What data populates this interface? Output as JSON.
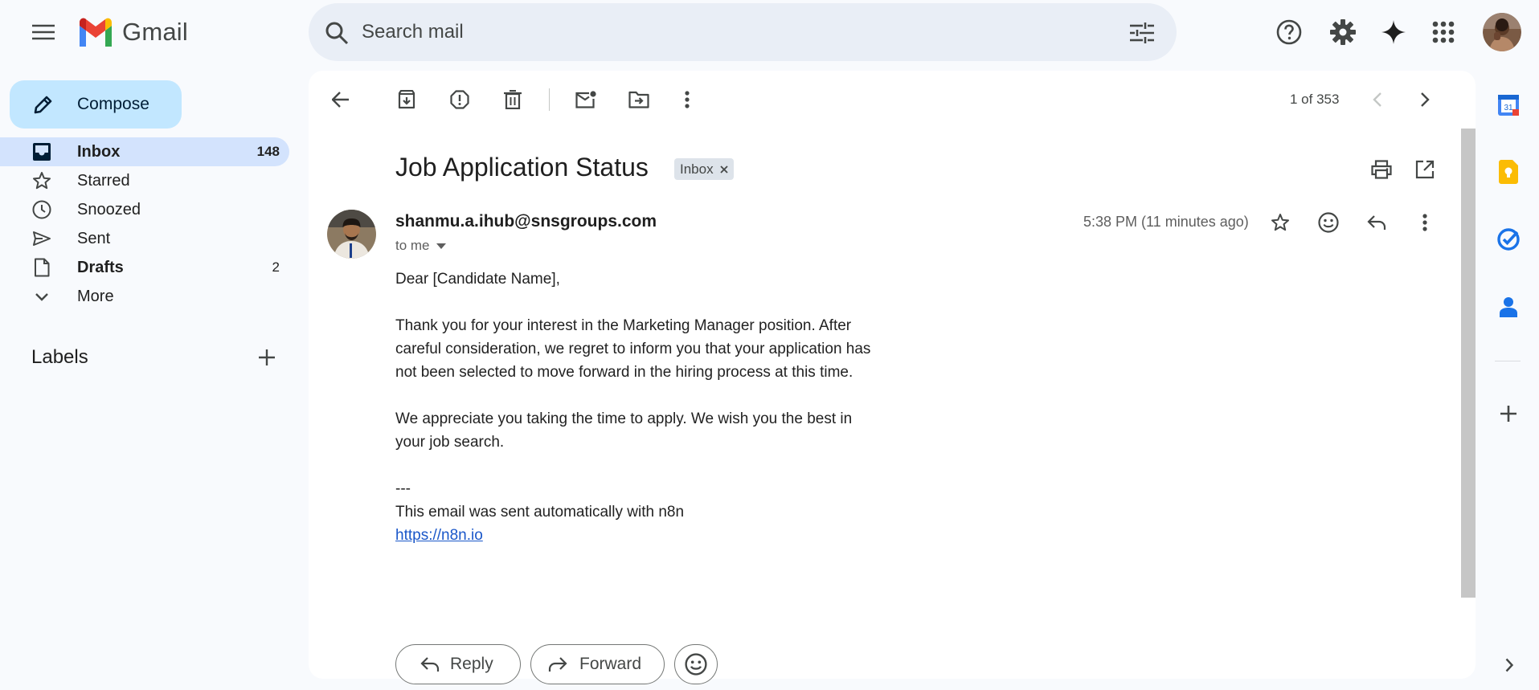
{
  "header": {
    "logo_text": "Gmail",
    "search_placeholder": "Search mail",
    "icons": [
      "menu-icon",
      "search-icon",
      "search-options-icon",
      "help-icon",
      "settings-icon",
      "gemini-icon",
      "apps-icon",
      "account-avatar"
    ]
  },
  "sidebar": {
    "compose_label": "Compose",
    "items": [
      {
        "label": "Inbox",
        "count": "148",
        "icon": "inbox-icon",
        "active": true
      },
      {
        "label": "Starred",
        "count": "",
        "icon": "star-icon"
      },
      {
        "label": "Snoozed",
        "count": "",
        "icon": "clock-icon"
      },
      {
        "label": "Sent",
        "count": "",
        "icon": "send-icon"
      },
      {
        "label": "Drafts",
        "count": "2",
        "icon": "draft-icon"
      },
      {
        "label": "More",
        "count": "",
        "icon": "chevron-down-icon"
      }
    ],
    "labels_title": "Labels"
  },
  "toolbar": {
    "counter": "1 of 353"
  },
  "email": {
    "subject": "Job Application Status",
    "label_chip": "Inbox",
    "sender": "shanmu.a.ihub@snsgroups.com",
    "to": "to me",
    "time": "5:38 PM (11 minutes ago)",
    "body": "Dear [Candidate Name],\n\nThank you for your interest in the Marketing Manager position. After careful consideration, we regret to inform you that your application has not been selected to move forward in the hiring process at this time.\n\nWe appreciate you taking the time to apply. We wish you the best in your job search.\n\n---\nThis email was sent automatically with n8n",
    "link": "https://n8n.io"
  },
  "actions": {
    "reply_label": "Reply",
    "forward_label": "Forward"
  },
  "colors": {
    "accent": "#0b57d0",
    "compose_bg": "#c2e7ff",
    "active_nav_bg": "#d3e3fd",
    "gmail_red": "#ea4335",
    "gmail_blue": "#4285f4",
    "gmail_green": "#34a853",
    "gmail_yellow": "#fbbc04"
  }
}
